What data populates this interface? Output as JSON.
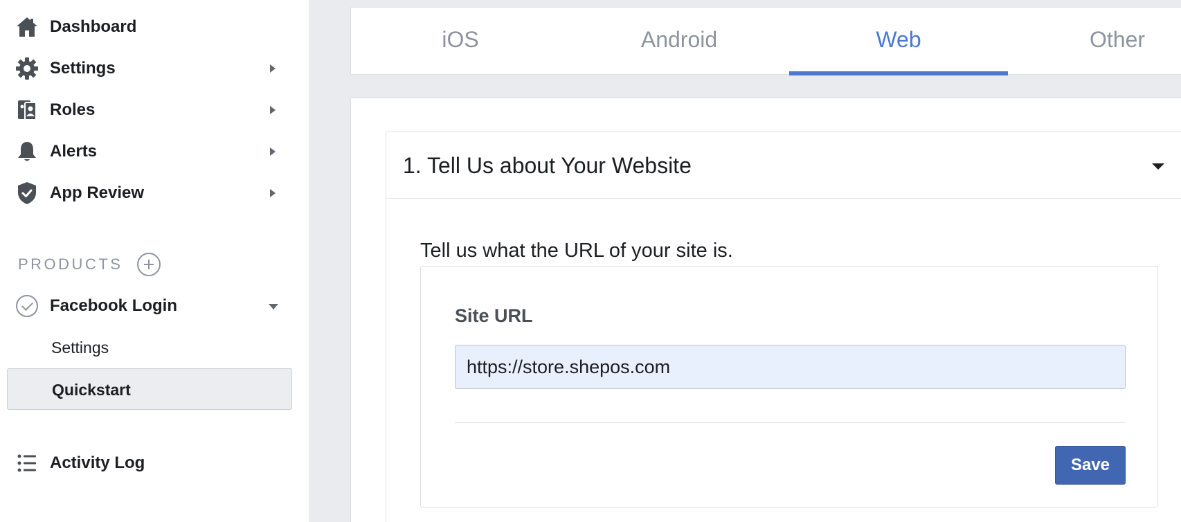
{
  "sidebar": {
    "items": [
      {
        "label": "Dashboard",
        "icon": "home-icon"
      },
      {
        "label": "Settings",
        "icon": "gear-icon"
      },
      {
        "label": "Roles",
        "icon": "roles-icon"
      },
      {
        "label": "Alerts",
        "icon": "bell-icon"
      },
      {
        "label": "App Review",
        "icon": "shield-check-icon"
      }
    ],
    "products_label": "PRODUCTS",
    "product": {
      "label": "Facebook Login",
      "subitems": [
        {
          "label": "Settings"
        },
        {
          "label": "Quickstart",
          "active": true
        }
      ]
    },
    "activity_log": {
      "label": "Activity Log",
      "icon": "list-icon"
    }
  },
  "tabs": [
    {
      "label": "iOS"
    },
    {
      "label": "Android"
    },
    {
      "label": "Web",
      "active": true
    },
    {
      "label": "Other"
    }
  ],
  "section": {
    "title": "1. Tell Us about Your Website",
    "description": "Tell us what the URL of your site is.",
    "field_label": "Site URL",
    "site_url_value": "https://store.shepos.com",
    "save_label": "Save"
  },
  "colors": {
    "accent": "#4a78d4",
    "save_button": "#4267b2",
    "input_background": "#e8f0fe",
    "sidebar_active": "#ebedf0",
    "page_background": "#e9ebee"
  }
}
